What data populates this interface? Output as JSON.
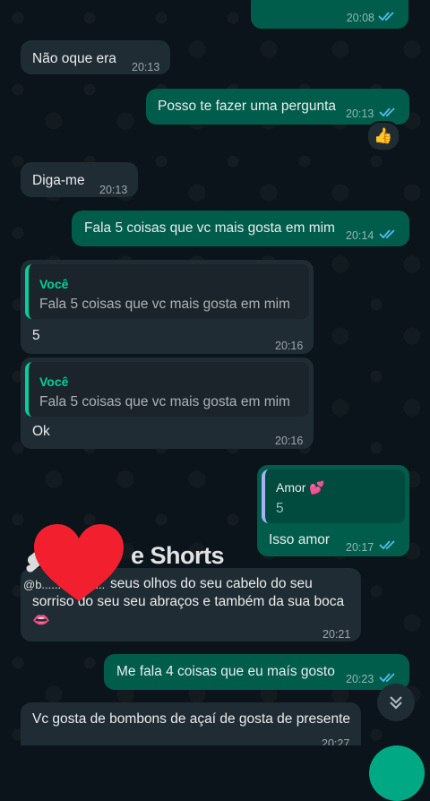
{
  "messages": {
    "m0": {
      "time": "20:08"
    },
    "m1": {
      "text": "Não oque era",
      "time": "20:13"
    },
    "m2": {
      "text": "Posso te fazer uma pergunta",
      "time": "20:13",
      "reaction": "👍"
    },
    "m3": {
      "text": "Diga-me",
      "time": "20:13"
    },
    "m4": {
      "text": "Fala 5 coisas que vc mais gosta em mim",
      "time": "20:14"
    },
    "m5": {
      "quote_author": "Você",
      "quote_text": "Fala 5 coisas que vc mais gosta em mim",
      "text": "5",
      "time": "20:16"
    },
    "m6": {
      "quote_author": "Você",
      "quote_text": "Fala 5 coisas que vc mais gosta em mim",
      "text": "Ok",
      "time": "20:16"
    },
    "m7": {
      "quote_author": "Amor 💕",
      "quote_text": "5",
      "text": "Isso amor",
      "time": "20:17"
    },
    "m8": {
      "line1": "seus olhos  do seu cabelo do seu",
      "line2": "sorriso do seu seu abraços e também da sua boca",
      "emoji": "👄",
      "time": "20:21"
    },
    "m9": {
      "text": "Me fala 4 coisas que eu maís gosto",
      "time": "20:23"
    },
    "m10": {
      "text": "Vc gosta de bombons de açaí de gosta de presente",
      "time": "20:27"
    }
  },
  "overlay": {
    "shorts_label": "e Shorts",
    "handle": "@b..........ison..."
  },
  "colors": {
    "background": "#0b141a",
    "incoming": "#202c33",
    "outgoing": "#005c4b",
    "read_ticks": "#53bdeb",
    "quote_accent": "#06cf9c"
  },
  "icons": {
    "read": "double-check-icon",
    "scroll": "double-chevron-down-icon",
    "heart": "heart-icon"
  }
}
